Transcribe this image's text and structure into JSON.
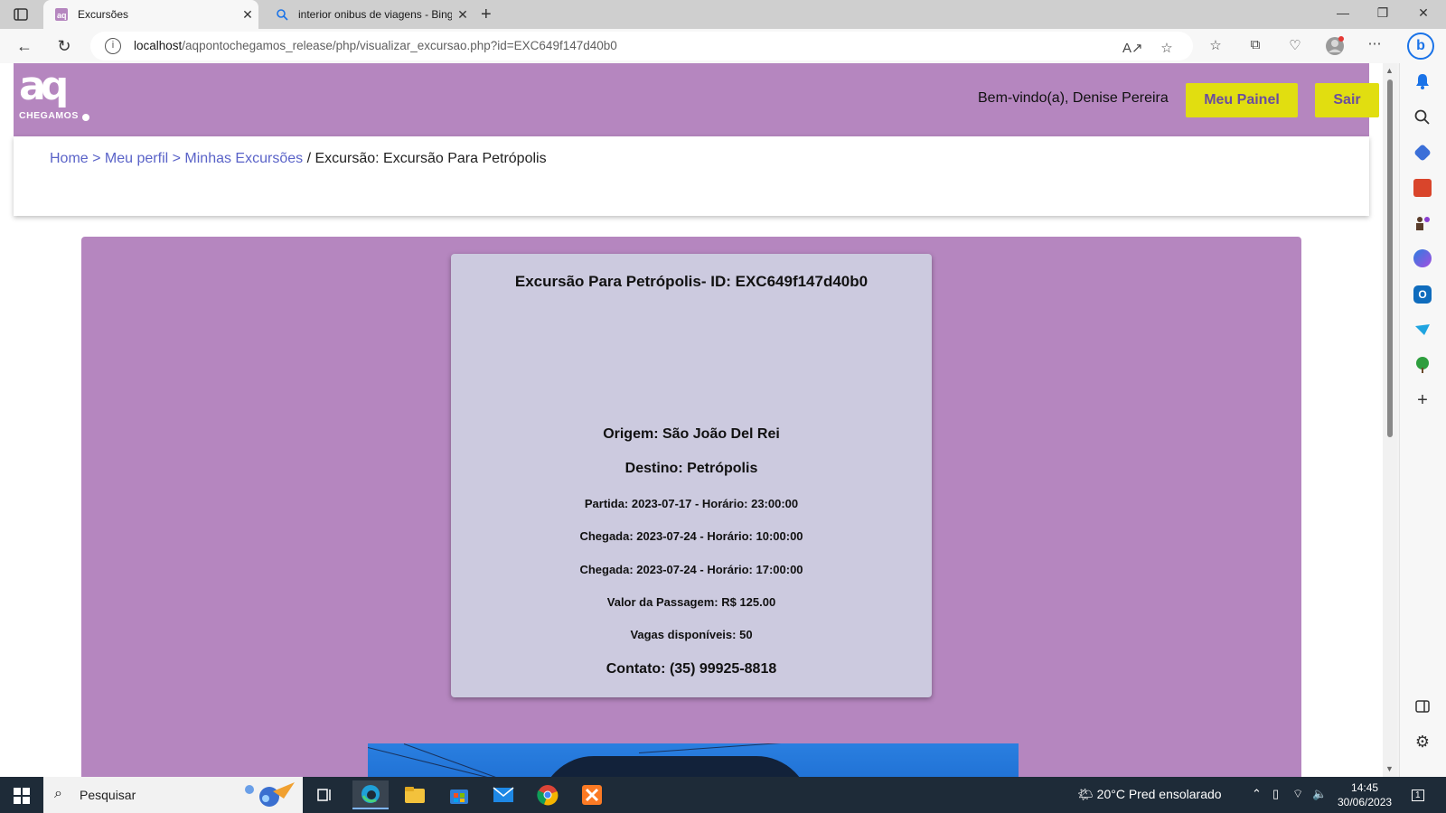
{
  "browser": {
    "tabs": [
      {
        "title": "Excursões",
        "active": true
      },
      {
        "title": "interior onibus de viagens - Bing",
        "active": false
      }
    ],
    "address": {
      "host": "localhost",
      "path": "/aqpontochegamos_release/php/visualizar_excursao.php?id=EXC649f147d40b0"
    }
  },
  "site": {
    "logo": {
      "mark": "aq",
      "word": "CHEGAMOS"
    },
    "welcome": "Bem-vindo(a), Denise Pereira",
    "buttons": {
      "painel": "Meu Painel",
      "sair": "Sair"
    },
    "breadcrumb": {
      "home": "Home",
      "sep1": " > ",
      "perfil": "Meu perfil",
      "sep2": " > ",
      "excursoes": "Minhas Excursões",
      "sep3": " / ",
      "current": "Excursão: Excursão Para Petrópolis"
    }
  },
  "excursion": {
    "title": "Excursão Para Petrópolis- ID: EXC649f147d40b0",
    "origem": "Origem: São João Del Rei",
    "destino": "Destino: Petrópolis",
    "partida": "Partida: 2023-07-17 - Horário: 23:00:00",
    "chegada1": "Chegada: 2023-07-24 - Horário: 10:00:00",
    "chegada2": "Chegada: 2023-07-24 - Horário: 17:00:00",
    "valor": "Valor da Passagem: R$ 125.00",
    "vagas": "Vagas disponíveis: 50",
    "contato": "Contato: (35) 99925-8818"
  },
  "taskbar": {
    "search_placeholder": "Pesquisar",
    "weather": "20°C  Pred ensolarado",
    "time": "14:45",
    "date": "30/06/2023",
    "notification_count": "1"
  },
  "colors": {
    "header_purple": "#b586bf",
    "button_yellow": "#e1de10",
    "card_lavender": "#cccadf",
    "link_blue": "#5a63c8"
  }
}
